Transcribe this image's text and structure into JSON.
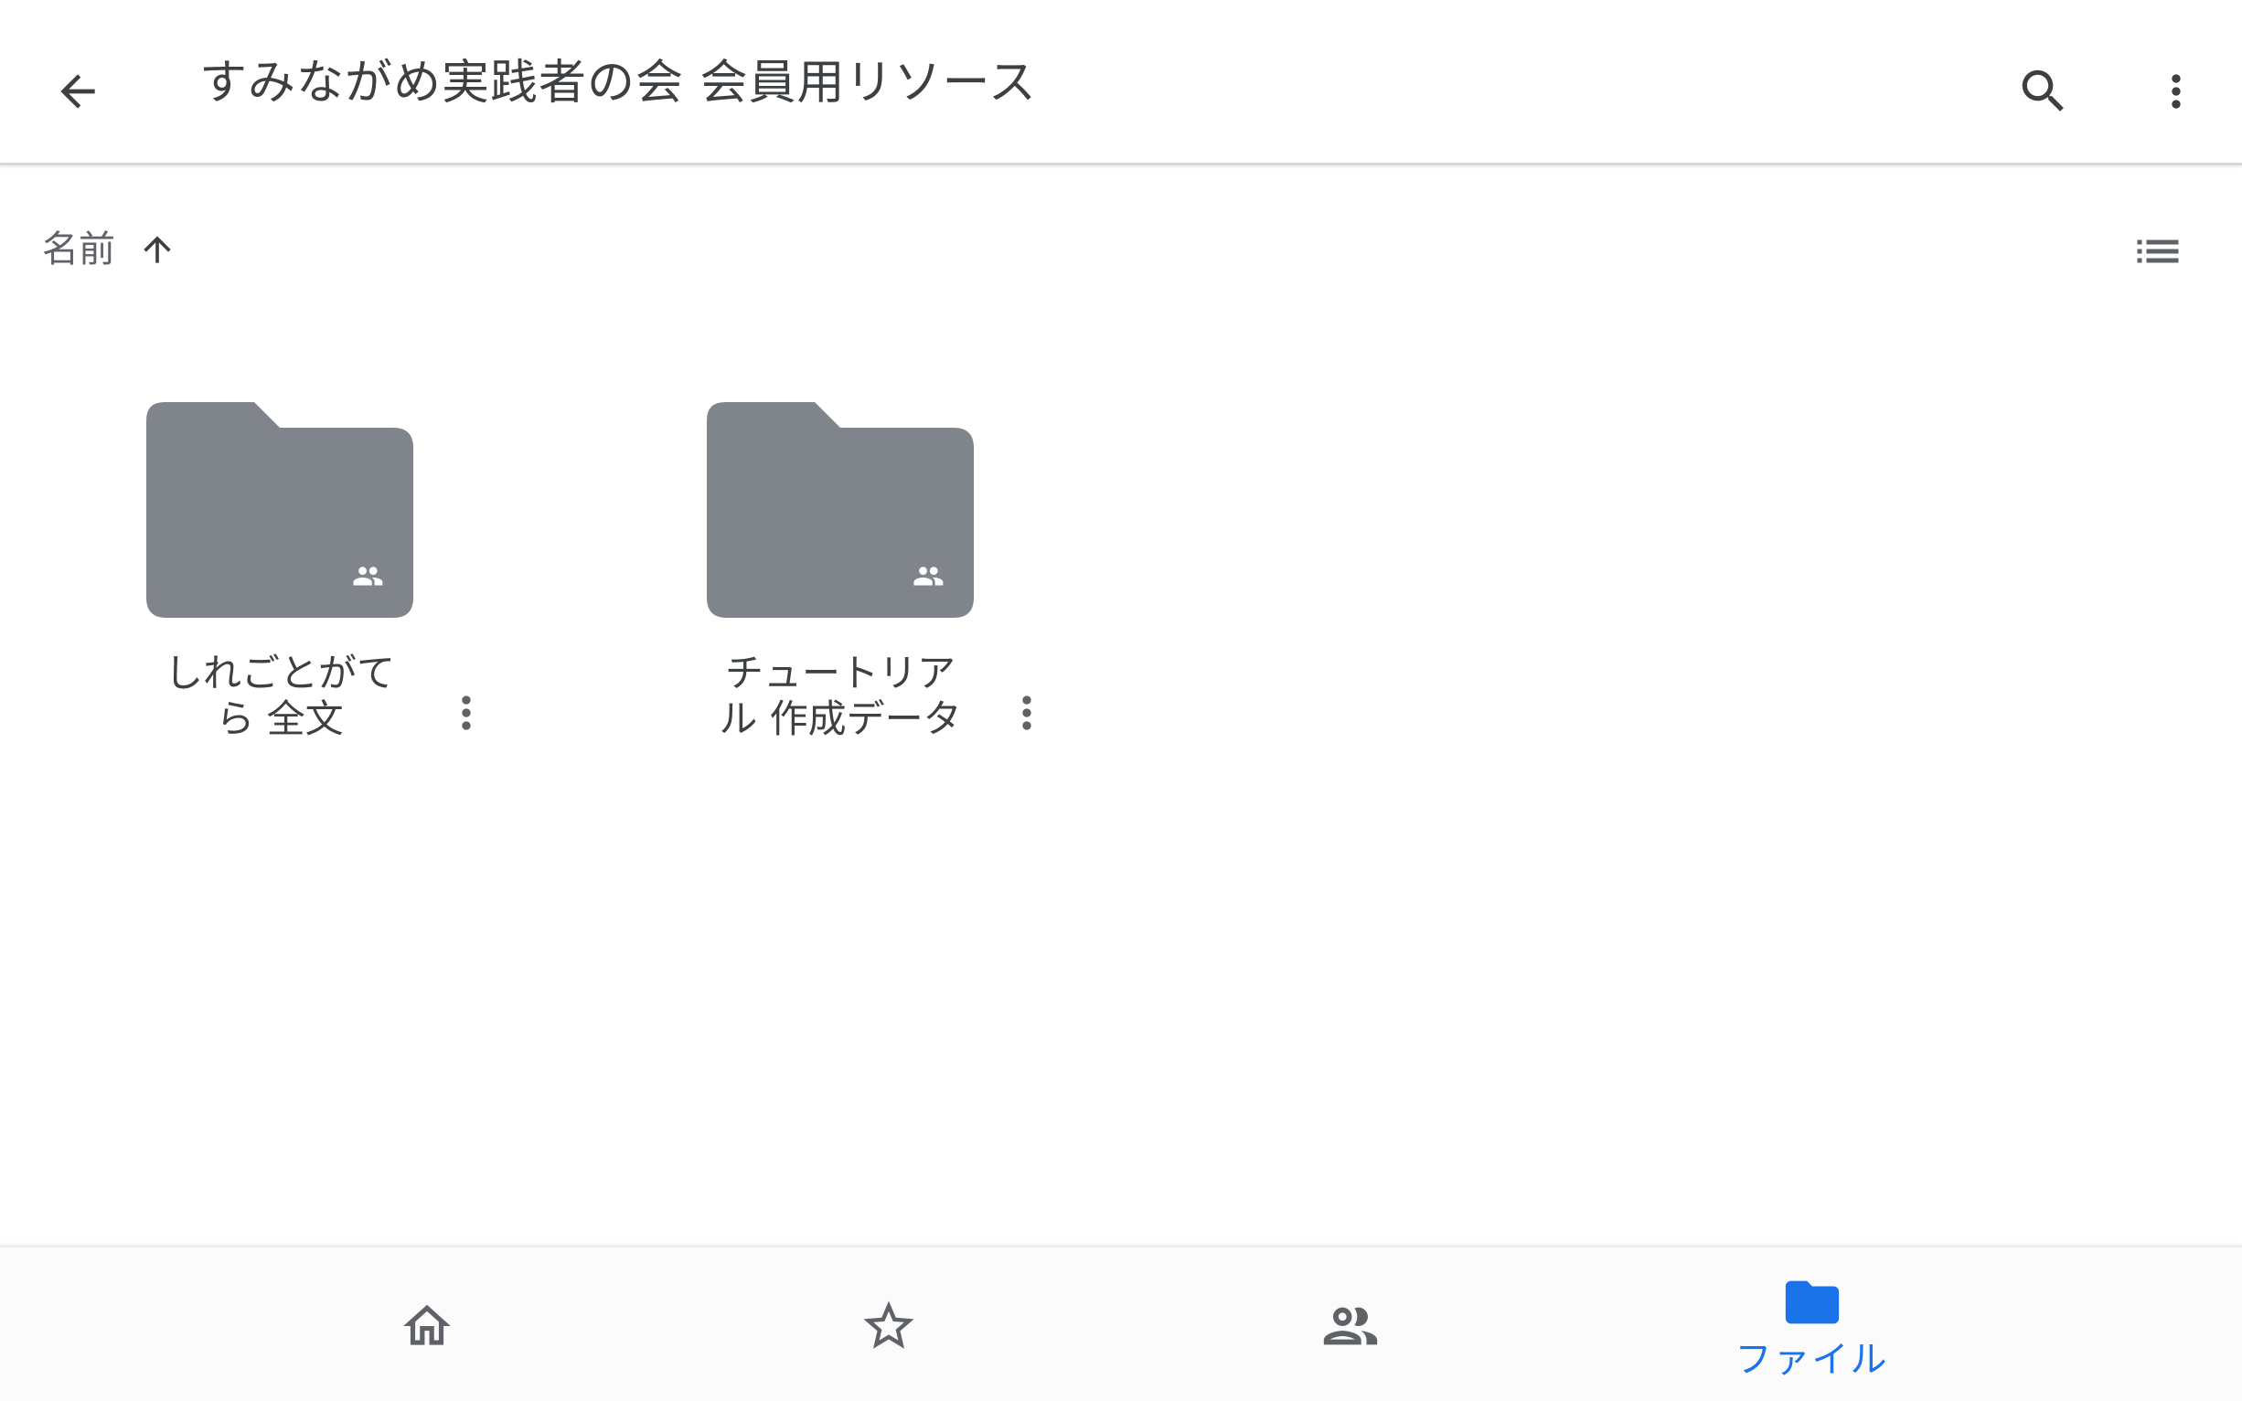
{
  "header": {
    "back_icon": "arrow-back-icon",
    "title": "すみながめ実践者の会 会員用リソース",
    "search_icon": "search-icon",
    "more_icon": "more-vert-icon"
  },
  "sort": {
    "label": "名前",
    "direction_icon": "arrow-upward-icon",
    "view_toggle_icon": "list-view-icon"
  },
  "folders": [
    {
      "name_line1": "しれごとがて",
      "name_line2": "ら 全文",
      "icon": "shared-folder-icon",
      "more_icon": "more-vert-icon"
    },
    {
      "name_line1": "チュートリア",
      "name_line2": "ル 作成データ",
      "icon": "shared-folder-icon",
      "more_icon": "more-vert-icon"
    }
  ],
  "bottom_nav": {
    "items": [
      {
        "icon": "home-icon",
        "label": ""
      },
      {
        "icon": "star-icon",
        "label": ""
      },
      {
        "icon": "shared-people-icon",
        "label": ""
      },
      {
        "icon": "folder-icon",
        "label": "ファイル",
        "active": true
      }
    ]
  },
  "colors": {
    "folder_gray": "#80858b",
    "active_blue": "#1a73e8",
    "icon_gray": "#5f6368",
    "text_dark": "#3c4043"
  }
}
